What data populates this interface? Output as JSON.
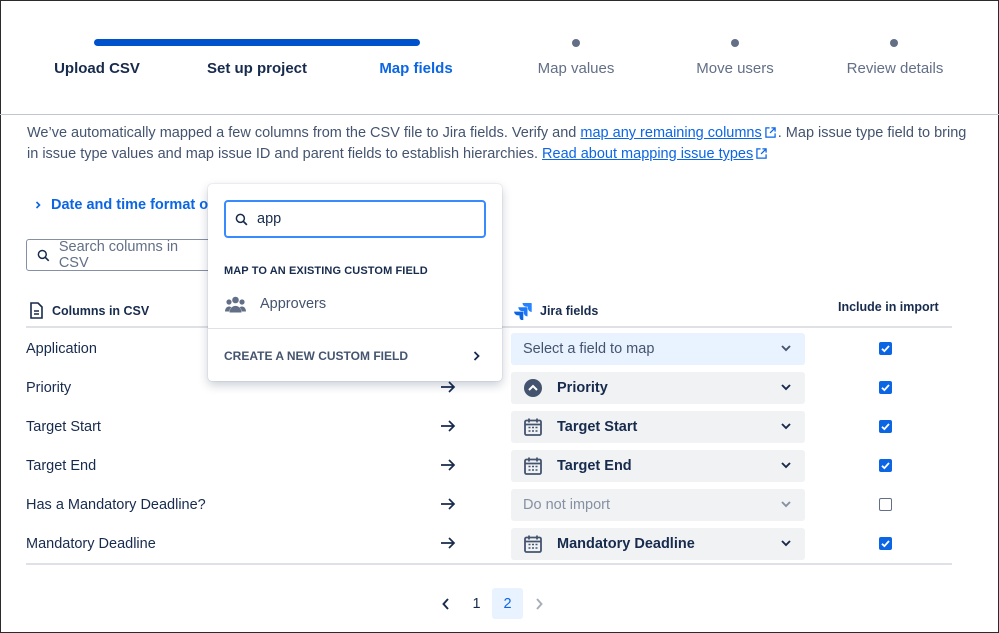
{
  "steps": [
    {
      "label": "Upload CSV",
      "state": "done"
    },
    {
      "label": "Set up project",
      "state": "done"
    },
    {
      "label": "Map fields",
      "state": "current"
    },
    {
      "label": "Map values",
      "state": "todo"
    },
    {
      "label": "Move users",
      "state": "todo"
    },
    {
      "label": "Review details",
      "state": "todo"
    }
  ],
  "intro": {
    "part1": "We’ve automatically mapped a few columns from the CSV file to Jira fields. Verify and ",
    "link1": "map any remaining columns",
    "part2": ". Map issue type field to bring in issue type values and map issue ID and parent fields to establish hierarchies. ",
    "link2": "Read about mapping issue types"
  },
  "date_toggle": "Date and time format opt",
  "csv_search": {
    "placeholder": "Search columns in CSV"
  },
  "headers": {
    "columns": "Columns in CSV",
    "jira": "Jira fields",
    "include": "Include in import"
  },
  "rows": [
    {
      "column": "Application",
      "field": "Select a field to map",
      "field_state": "select",
      "icon": "none",
      "include": true
    },
    {
      "column": "Priority",
      "field": "Priority",
      "field_state": "mapped",
      "icon": "priority-icon",
      "include": true
    },
    {
      "column": "Target Start",
      "field": "Target Start",
      "field_state": "mapped",
      "icon": "calendar-icon",
      "include": true
    },
    {
      "column": "Target End",
      "field": "Target End",
      "field_state": "mapped",
      "icon": "calendar-icon",
      "include": true
    },
    {
      "column": "Has a Mandatory Deadline?",
      "field": "Do not import",
      "field_state": "disabled",
      "icon": "none",
      "include": false
    },
    {
      "column": "Mandatory Deadline",
      "field": "Mandatory Deadline",
      "field_state": "mapped",
      "icon": "calendar-icon",
      "include": true
    }
  ],
  "pagination": {
    "pages": [
      "1",
      "2"
    ],
    "current": "2"
  },
  "popup": {
    "search_value": "app",
    "section_title": "MAP TO AN EXISTING CUSTOM FIELD",
    "option": "Approvers",
    "create_label": "CREATE A NEW CUSTOM FIELD"
  },
  "colors": {
    "accent": "#0C66E4",
    "progress": "#0052CC",
    "text": "#172B4D",
    "subtle": "#626F86"
  }
}
